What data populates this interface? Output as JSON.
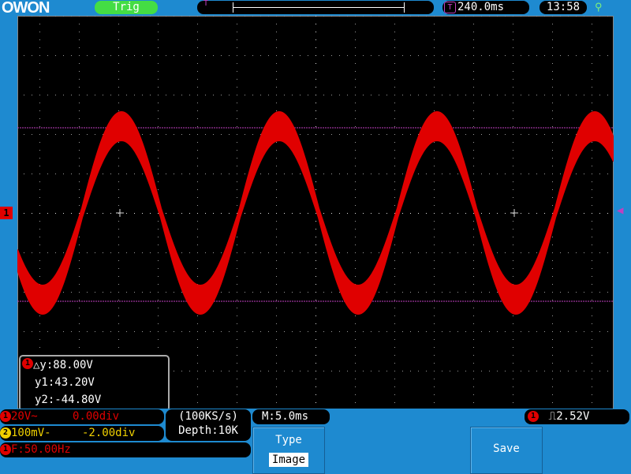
{
  "brand": "OWON",
  "status": {
    "trigger_state": "Trig",
    "trigger_position": "240.0ms",
    "clock": "13:58"
  },
  "icons": {
    "trigger_marker": "trigger-position-icon",
    "usb": "usb-icon"
  },
  "channel_marker": "1",
  "measure": {
    "channel": "1",
    "delta_y": "△y:88.00V",
    "y1": "y1:43.20V",
    "y2": "y2:-44.80V"
  },
  "ch1": {
    "num": "1",
    "scale": "20V~",
    "offset": "0.00div",
    "color": "#e00000"
  },
  "ch2": {
    "num": "2",
    "scale": "100mV-",
    "offset": "-2.00div",
    "color": "#f0d000"
  },
  "freq": {
    "num": "1",
    "text": "F:50.00Hz"
  },
  "sample": {
    "rate": "(100KS/s)",
    "depth": "Depth:10K"
  },
  "timebase": "M:5.0ms",
  "trigger": {
    "num": "1",
    "level": "2.52V"
  },
  "menu": {
    "type_label": "Type",
    "type_value": "Image",
    "save_label": "Save"
  },
  "waveform": {
    "frequency_hz": 50,
    "amplitude_v": 44,
    "volts_per_div": 20,
    "time_per_div_ms": 5,
    "cursor_y1_v": 43.2,
    "cursor_y2_v": -44.8
  }
}
